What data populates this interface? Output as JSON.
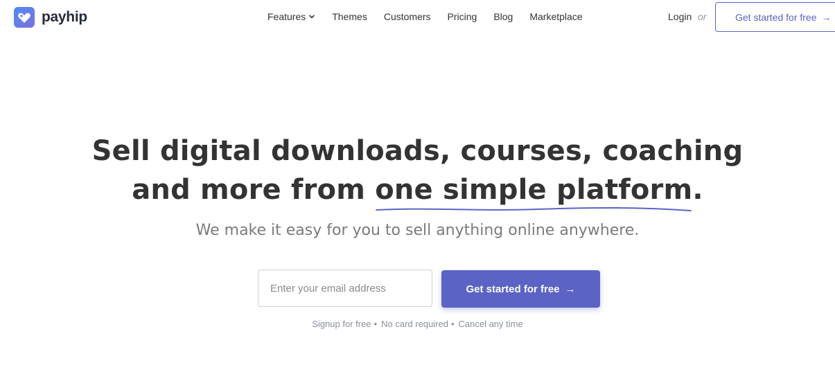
{
  "brand": {
    "name": "payhip",
    "accent": "#5b63c5",
    "logo_icon": "heart-tag-icon"
  },
  "nav": {
    "items": [
      {
        "label": "Features",
        "has_dropdown": true
      },
      {
        "label": "Themes"
      },
      {
        "label": "Customers"
      },
      {
        "label": "Pricing"
      },
      {
        "label": "Blog"
      },
      {
        "label": "Marketplace"
      }
    ],
    "login": "Login",
    "or": "or",
    "cta": "Get started for free",
    "cta_icon": "arrow-right-icon"
  },
  "hero": {
    "title_line1": "Sell digital downloads, courses, coaching",
    "title_line2_prefix": "and more from ",
    "title_highlight": "one simple platform",
    "title_suffix": ".",
    "subtitle": "We make it easy for you to sell anything online anywhere.",
    "email_placeholder": "Enter your email address",
    "email_value": "",
    "cta": "Get started for free",
    "fineprint": [
      "Signup for free",
      "No card required",
      "Cancel any time"
    ]
  }
}
